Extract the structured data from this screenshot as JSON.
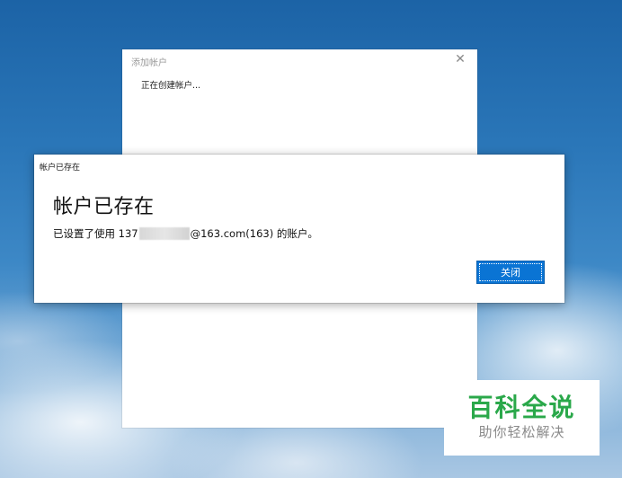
{
  "back_window": {
    "title": "添加帐户",
    "close_glyph": "✕",
    "status_text": "正在创建帐户..."
  },
  "dialog": {
    "titlebar": "帐户已存在",
    "heading": "帐户已存在",
    "message_prefix": "已设置了使用 137",
    "message_suffix": "@163.com(163) 的账户。",
    "close_button_label": "关闭"
  },
  "watermark": {
    "main": "百科全说",
    "sub": "助你轻松解决"
  },
  "colors": {
    "accent_button": "#0a74d4",
    "watermark_green": "#2aa84a"
  }
}
